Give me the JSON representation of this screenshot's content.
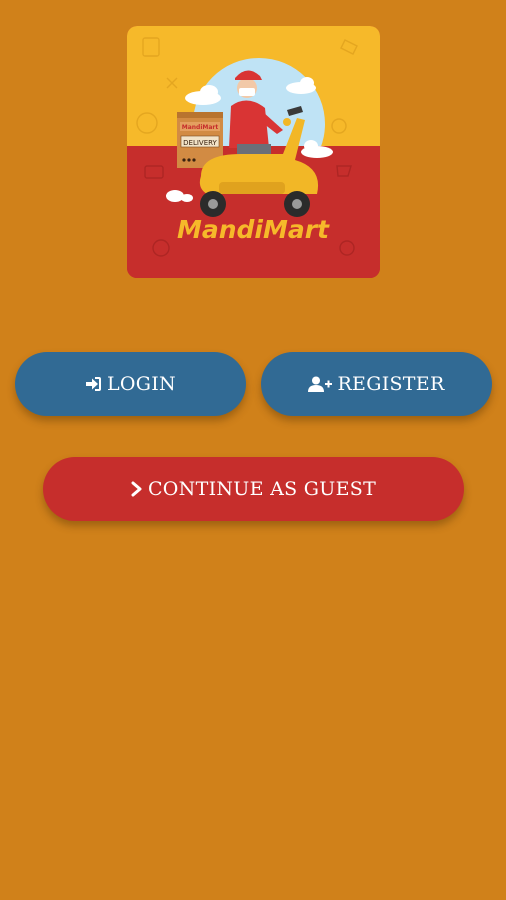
{
  "logo": {
    "brand": "MandiMart",
    "box_brand": "MandiMart",
    "box_label": "DELIVERY"
  },
  "actions": {
    "login_label": "LOGIN",
    "register_label": "REGISTER",
    "guest_label": "CONTINUE AS GUEST"
  },
  "icons": {
    "login": "sign-in-icon",
    "register": "user-plus-icon",
    "guest": "chevron-right-icon"
  },
  "colors": {
    "background": "#D0811A",
    "primary_button": "#316A94",
    "guest_button": "#C62E2C",
    "logo_yellow": "#F6B92A",
    "logo_red": "#C62E2C"
  }
}
